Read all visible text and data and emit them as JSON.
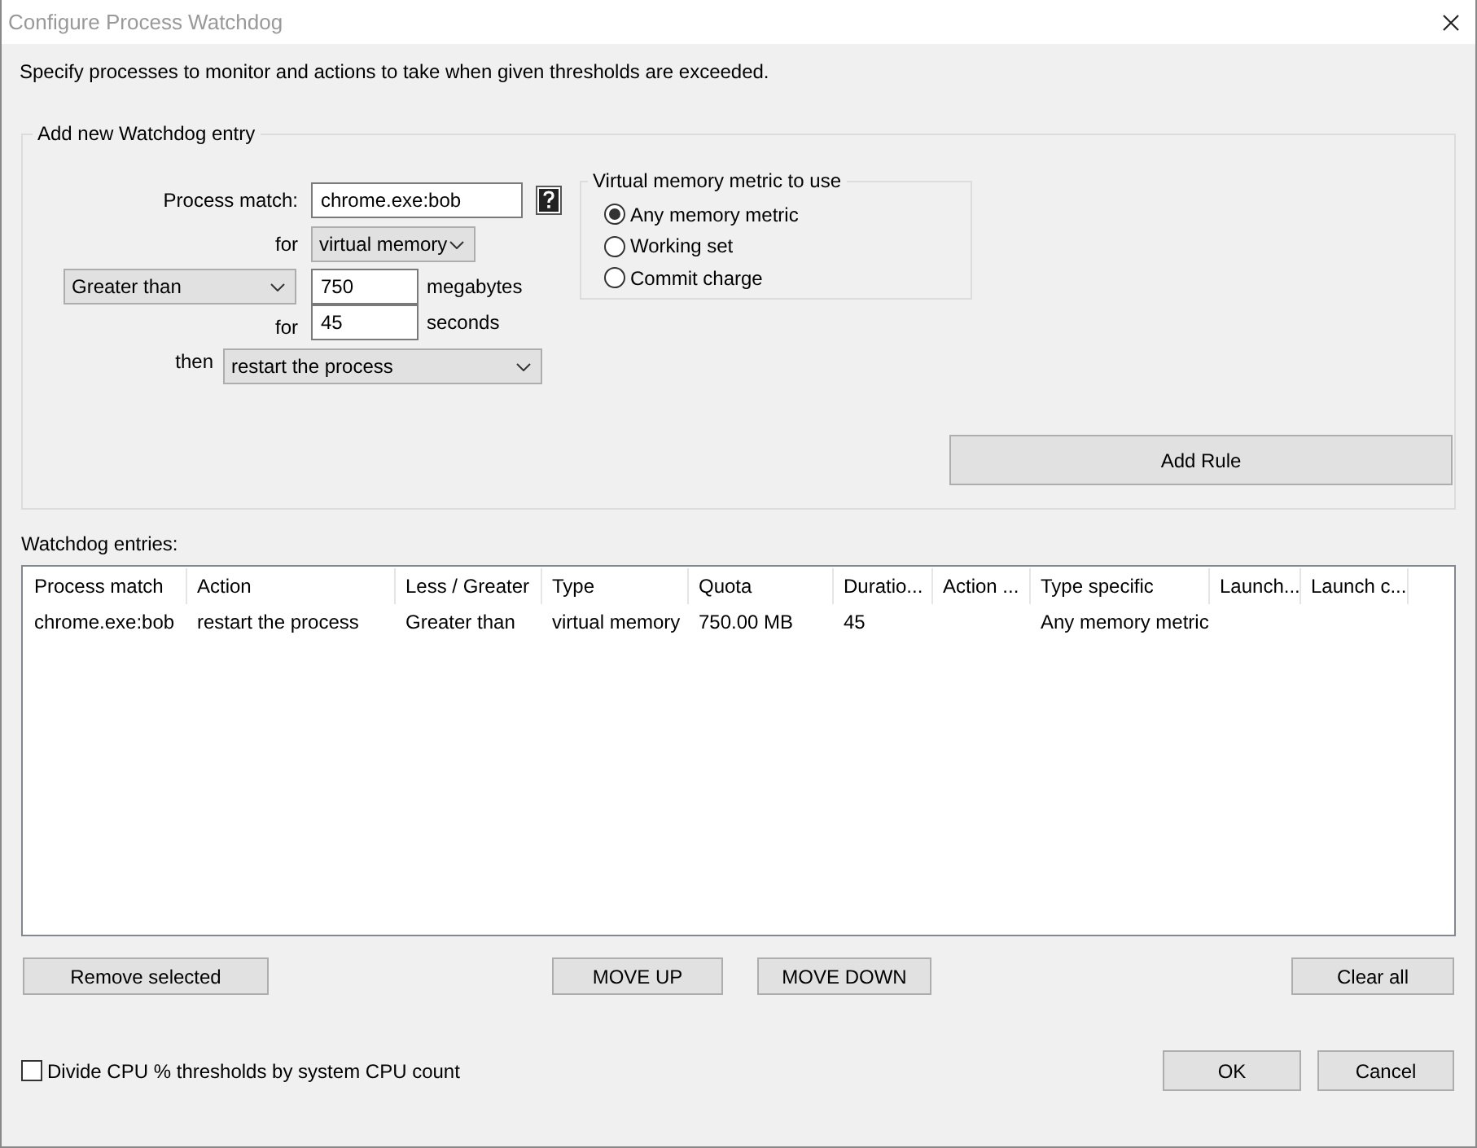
{
  "window": {
    "title": "Configure Process Watchdog"
  },
  "description": "Specify processes to monitor and actions to take when given thresholds are exceeded.",
  "new_entry": {
    "legend": "Add new Watchdog entry",
    "process_match": {
      "label": "Process match:",
      "value": "chrome.exe:bob"
    },
    "resource": {
      "label": "for",
      "value": "virtual memory"
    },
    "comparison": {
      "value": "Greater than"
    },
    "threshold": {
      "value": "750",
      "unit": "megabytes"
    },
    "duration": {
      "label": "for",
      "value": "45",
      "unit": "seconds"
    },
    "action": {
      "label": "then",
      "value": "restart the process"
    },
    "metric_group": {
      "legend": "Virtual memory metric to use",
      "options": [
        {
          "label": "Any memory metric",
          "selected": true
        },
        {
          "label": "Working set",
          "selected": false
        },
        {
          "label": "Commit charge",
          "selected": false
        }
      ]
    },
    "add_button": "Add Rule"
  },
  "entries": {
    "label": "Watchdog entries:",
    "columns": [
      "Process match",
      "Action",
      "Less / Greater",
      "Type",
      "Quota",
      "Duratio...",
      "Action ...",
      "Type specific",
      "Launch...",
      "Launch c..."
    ],
    "rows": [
      [
        "chrome.exe:bob",
        "restart the process",
        "Greater than",
        "virtual memory",
        "750.00 MB",
        "45",
        "",
        "Any memory metric",
        "",
        ""
      ]
    ]
  },
  "remove_button": "Remove selected",
  "move_up_button": "MOVE UP",
  "move_down_button": "MOVE DOWN",
  "clear_button": "Clear all",
  "divide_cpu": {
    "label": "Divide CPU % thresholds by system CPU count",
    "checked": false
  },
  "ok_button": "OK",
  "cancel_button": "Cancel"
}
